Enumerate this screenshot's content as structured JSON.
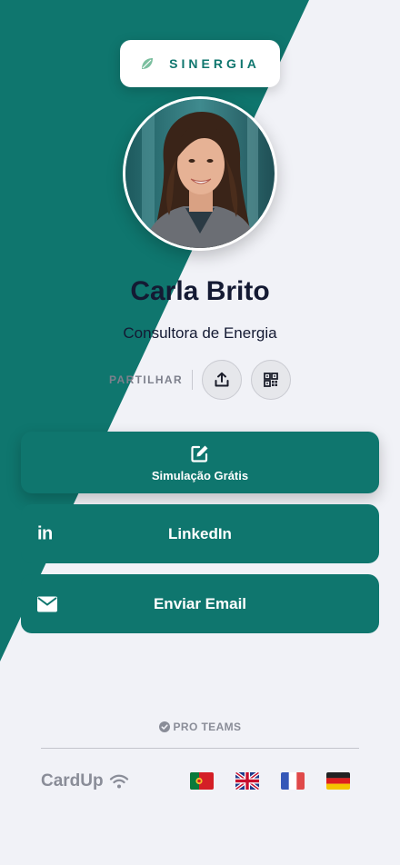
{
  "brand": {
    "name": "SINERGIA"
  },
  "profile": {
    "name": "Carla Brito",
    "title": "Consultora de Energia",
    "photo_alt": "Carla Brito portrait"
  },
  "share": {
    "label": "PARTILHAR"
  },
  "actions": [
    {
      "label": "Simulação Grátis",
      "icon": "edit-icon"
    },
    {
      "label": "LinkedIn",
      "icon": "linkedin-icon"
    },
    {
      "label": "Enviar Email",
      "icon": "envelope-icon"
    }
  ],
  "footer": {
    "badge": "PRO TEAMS",
    "brand": "CardUp",
    "languages": [
      "pt",
      "en",
      "fr",
      "de"
    ]
  },
  "colors": {
    "primary": "#0f766e",
    "background": "#f1f2f7",
    "text": "#141a33"
  }
}
